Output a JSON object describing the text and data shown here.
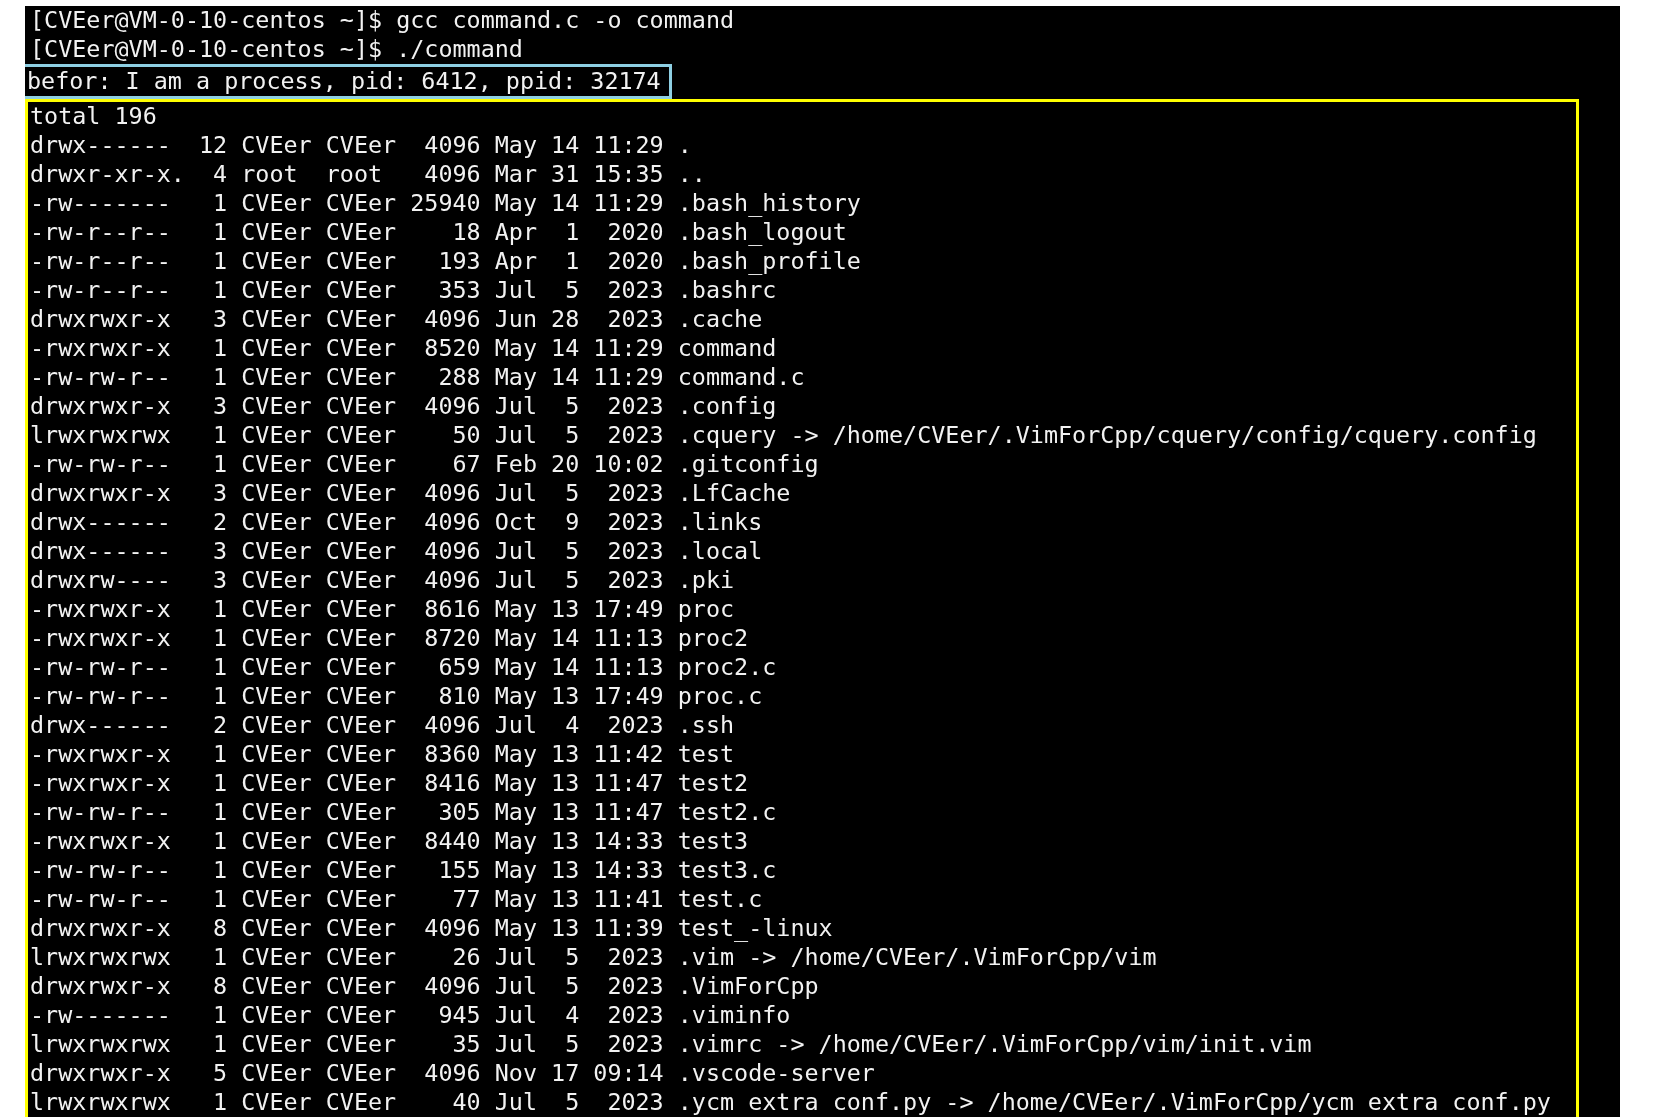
{
  "terminal": {
    "blocks": [
      {
        "lines": [
          "[CVEer@VM-0-10-centos ~]$ gcc command.c -o command",
          "[CVEer@VM-0-10-centos ~]$ ./command"
        ]
      },
      {
        "color": "#8ecfe3",
        "lines": [
          "befor: I am a process, pid: 6412, ppid: 32174"
        ]
      },
      {
        "color": "#ffff00",
        "lines": [
          "total 196",
          "drwx------  12 CVEer CVEer  4096 May 14 11:29 .",
          "drwxr-xr-x.  4 root  root   4096 Mar 31 15:35 ..",
          "-rw-------   1 CVEer CVEer 25940 May 14 11:29 .bash_history",
          "-rw-r--r--   1 CVEer CVEer    18 Apr  1  2020 .bash_logout",
          "-rw-r--r--   1 CVEer CVEer   193 Apr  1  2020 .bash_profile",
          "-rw-r--r--   1 CVEer CVEer   353 Jul  5  2023 .bashrc",
          "drwxrwxr-x   3 CVEer CVEer  4096 Jun 28  2023 .cache",
          "-rwxrwxr-x   1 CVEer CVEer  8520 May 14 11:29 command",
          "-rw-rw-r--   1 CVEer CVEer   288 May 14 11:29 command.c",
          "drwxrwxr-x   3 CVEer CVEer  4096 Jul  5  2023 .config",
          "lrwxrwxrwx   1 CVEer CVEer    50 Jul  5  2023 .cquery -> /home/CVEer/.VimForCpp/cquery/config/cquery.config",
          "-rw-rw-r--   1 CVEer CVEer    67 Feb 20 10:02 .gitconfig",
          "drwxrwxr-x   3 CVEer CVEer  4096 Jul  5  2023 .LfCache",
          "drwx------   2 CVEer CVEer  4096 Oct  9  2023 .links",
          "drwx------   3 CVEer CVEer  4096 Jul  5  2023 .local",
          "drwxrw----   3 CVEer CVEer  4096 Jul  5  2023 .pki",
          "-rwxrwxr-x   1 CVEer CVEer  8616 May 13 17:49 proc",
          "-rwxrwxr-x   1 CVEer CVEer  8720 May 14 11:13 proc2",
          "-rw-rw-r--   1 CVEer CVEer   659 May 14 11:13 proc2.c",
          "-rw-rw-r--   1 CVEer CVEer   810 May 13 17:49 proc.c",
          "drwx------   2 CVEer CVEer  4096 Jul  4  2023 .ssh",
          "-rwxrwxr-x   1 CVEer CVEer  8360 May 13 11:42 test",
          "-rwxrwxr-x   1 CVEer CVEer  8416 May 13 11:47 test2",
          "-rw-rw-r--   1 CVEer CVEer   305 May 13 11:47 test2.c",
          "-rwxrwxr-x   1 CVEer CVEer  8440 May 13 14:33 test3",
          "-rw-rw-r--   1 CVEer CVEer   155 May 13 14:33 test3.c",
          "-rw-rw-r--   1 CVEer CVEer    77 May 13 11:41 test.c",
          "drwxrwxr-x   8 CVEer CVEer  4096 May 13 11:39 test_-linux",
          "lrwxrwxrwx   1 CVEer CVEer    26 Jul  5  2023 .vim -> /home/CVEer/.VimForCpp/vim",
          "drwxrwxr-x   8 CVEer CVEer  4096 Jul  5  2023 .VimForCpp",
          "-rw-------   1 CVEer CVEer   945 Jul  4  2023 .viminfo",
          "lrwxrwxrwx   1 CVEer CVEer    35 Jul  5  2023 .vimrc -> /home/CVEer/.VimForCpp/vim/init.vim",
          "drwxrwxr-x   5 CVEer CVEer  4096 Nov 17 09:14 .vscode-server",
          "lrwxrwxrwx   1 CVEer CVEer    40 Jul  5  2023 .ycm extra conf.py -> /home/CVEer/.VimForCpp/ycm extra conf.py"
        ]
      }
    ]
  }
}
